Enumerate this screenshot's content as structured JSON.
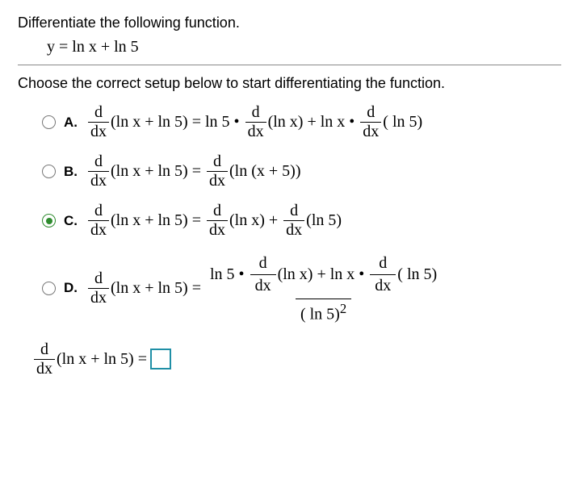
{
  "prompt": "Differentiate the following function.",
  "equation": "y = ln x + ln 5",
  "instruction": "Choose the correct setup below to start differentiating the function.",
  "options": {
    "A": {
      "letter": "A.",
      "lhs_arg": "(ln x + ln 5) = ",
      "rhs_a": "ln 5 •",
      "rhs_arg1": "(ln x) + ln x •",
      "rhs_arg2": "( ln 5)"
    },
    "B": {
      "letter": "B.",
      "lhs_arg": "(ln x + ln 5) = ",
      "rhs_arg": "(ln (x + 5))"
    },
    "C": {
      "letter": "C.",
      "lhs_arg": "(ln x + ln 5) = ",
      "rhs_arg1": "(ln x) + ",
      "rhs_arg2": "(ln 5)"
    },
    "D": {
      "letter": "D.",
      "lhs_arg": "(ln x + ln 5) = ",
      "num_a": "ln 5 •",
      "num_arg1": "(ln x) + ln x •",
      "num_arg2": "( ln 5)",
      "den": "( ln 5)",
      "den_exp": "2"
    }
  },
  "ddx": {
    "num": "d",
    "den": "dx"
  },
  "final_lhs_arg": "(ln x + ln 5) = ",
  "selected": "C"
}
